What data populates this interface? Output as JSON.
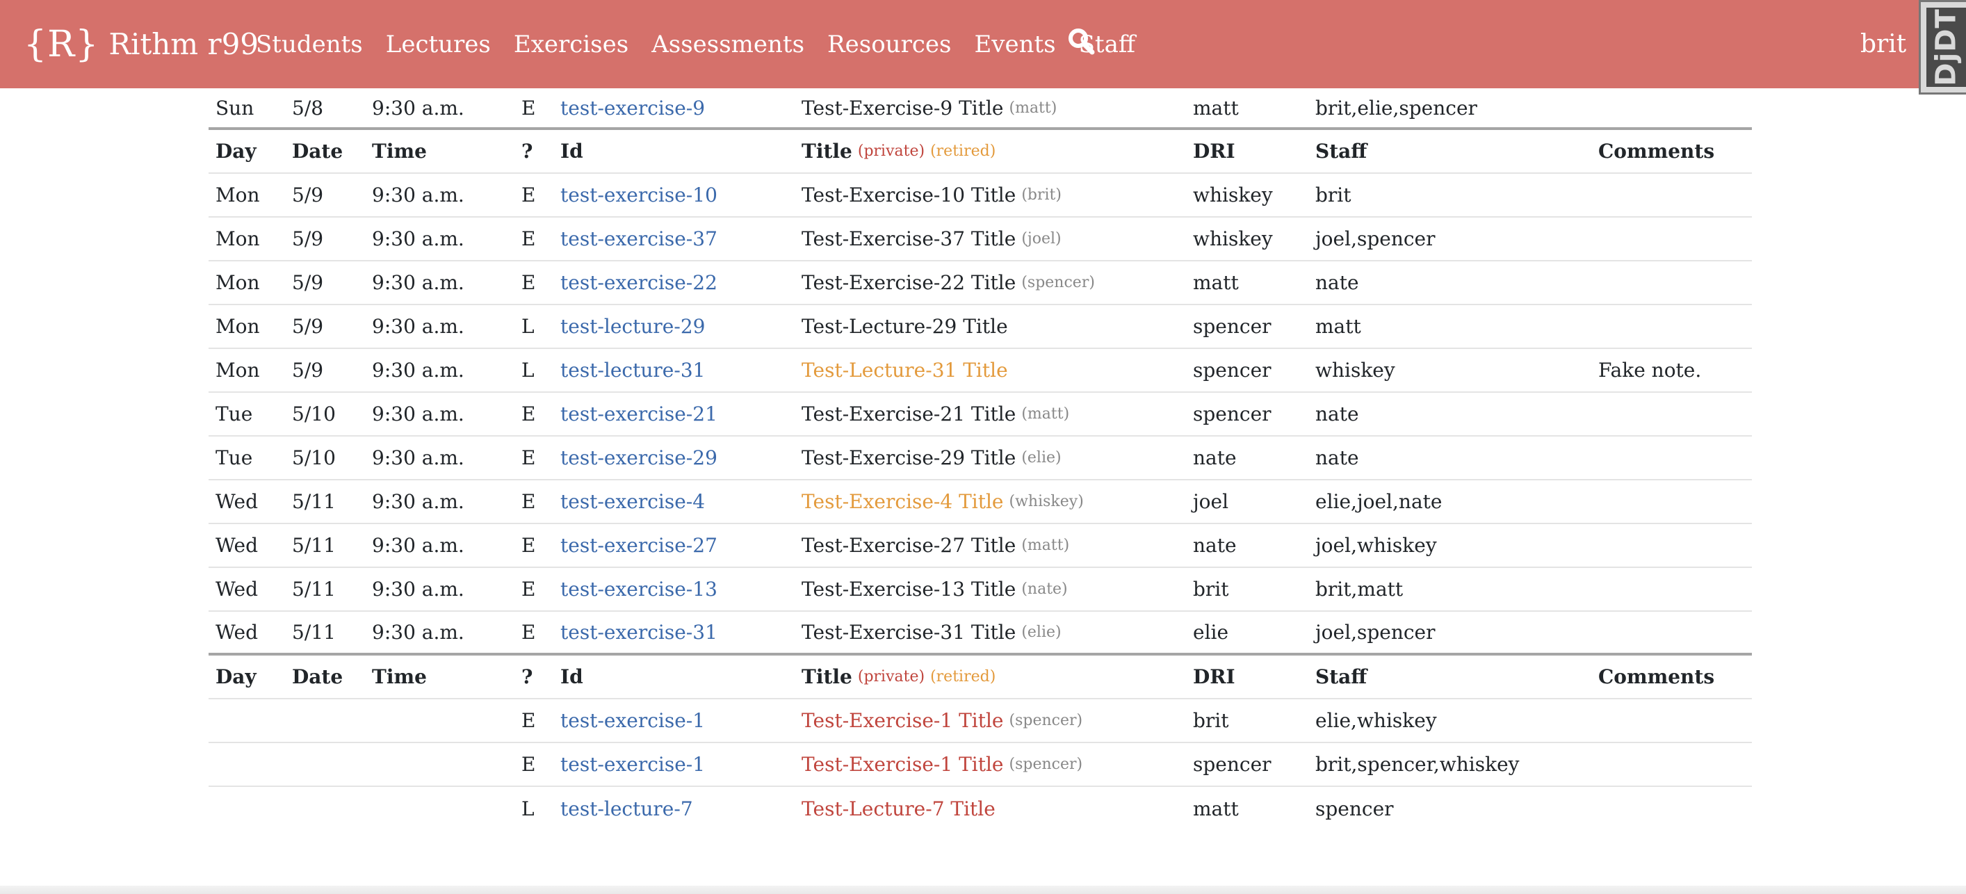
{
  "brand": {
    "mark": "{R}",
    "name": "Rithm r99"
  },
  "nav": [
    "Students",
    "Lectures",
    "Exercises",
    "Assessments",
    "Resources",
    "Events",
    "Staff"
  ],
  "user": {
    "name": "brit"
  },
  "djdt": "DjDT",
  "header": {
    "day": "Day",
    "date": "Date",
    "time": "Time",
    "kind": "?",
    "id": "Id",
    "title": "Title",
    "private": "(private)",
    "retired": "(retired)",
    "dri": "DRI",
    "staff": "Staff",
    "comments": "Comments"
  },
  "top_row": {
    "day": "Sun",
    "date": "5/8",
    "time": "9:30 a.m.",
    "kind": "E",
    "id": "test-exercise-9",
    "title": "Test-Exercise-9 Title",
    "owner": "(matt)",
    "dri": "matt",
    "staff": "brit,elie,spencer",
    "comments": ""
  },
  "rows": [
    {
      "day": "Mon",
      "date": "5/9",
      "time": "9:30 a.m.",
      "kind": "E",
      "id": "test-exercise-10",
      "title": "Test-Exercise-10 Title",
      "owner": "(brit)",
      "dri": "whiskey",
      "staff": "brit",
      "comments": ""
    },
    {
      "day": "Mon",
      "date": "5/9",
      "time": "9:30 a.m.",
      "kind": "E",
      "id": "test-exercise-37",
      "title": "Test-Exercise-37 Title",
      "owner": "(joel)",
      "dri": "whiskey",
      "staff": "joel,spencer",
      "comments": ""
    },
    {
      "day": "Mon",
      "date": "5/9",
      "time": "9:30 a.m.",
      "kind": "E",
      "id": "test-exercise-22",
      "title": "Test-Exercise-22 Title",
      "owner": "(spencer)",
      "dri": "matt",
      "staff": "nate",
      "comments": ""
    },
    {
      "day": "Mon",
      "date": "5/9",
      "time": "9:30 a.m.",
      "kind": "L",
      "id": "test-lecture-29",
      "title": "Test-Lecture-29 Title",
      "owner": "",
      "dri": "spencer",
      "staff": "matt",
      "comments": ""
    },
    {
      "day": "Mon",
      "date": "5/9",
      "time": "9:30 a.m.",
      "kind": "L",
      "id": "test-lecture-31",
      "title": "Test-Lecture-31 Title",
      "owner": "",
      "dri": "spencer",
      "staff": "whiskey",
      "comments": "Fake note."
    },
    {
      "day": "Tue",
      "date": "5/10",
      "time": "9:30 a.m.",
      "kind": "E",
      "id": "test-exercise-21",
      "title": "Test-Exercise-21 Title",
      "owner": "(matt)",
      "dri": "spencer",
      "staff": "nate",
      "comments": ""
    },
    {
      "day": "Tue",
      "date": "5/10",
      "time": "9:30 a.m.",
      "kind": "E",
      "id": "test-exercise-29",
      "title": "Test-Exercise-29 Title",
      "owner": "(elie)",
      "dri": "nate",
      "staff": "nate",
      "comments": ""
    },
    {
      "day": "Wed",
      "date": "5/11",
      "time": "9:30 a.m.",
      "kind": "E",
      "id": "test-exercise-4",
      "title": "Test-Exercise-4 Title",
      "owner": "(whiskey)",
      "dri": "joel",
      "staff": "elie,joel,nate",
      "comments": ""
    },
    {
      "day": "Wed",
      "date": "5/11",
      "time": "9:30 a.m.",
      "kind": "E",
      "id": "test-exercise-27",
      "title": "Test-Exercise-27 Title",
      "owner": "(matt)",
      "dri": "nate",
      "staff": "joel,whiskey",
      "comments": ""
    },
    {
      "day": "Wed",
      "date": "5/11",
      "time": "9:30 a.m.",
      "kind": "E",
      "id": "test-exercise-13",
      "title": "Test-Exercise-13 Title",
      "owner": "(nate)",
      "dri": "brit",
      "staff": "brit,matt",
      "comments": ""
    },
    {
      "day": "Wed",
      "date": "5/11",
      "time": "9:30 a.m.",
      "kind": "E",
      "id": "test-exercise-31",
      "title": "Test-Exercise-31 Title",
      "owner": "(elie)",
      "dri": "elie",
      "staff": "joel,spencer",
      "comments": ""
    }
  ],
  "unscheduled": [
    {
      "day": "",
      "date": "",
      "time": "",
      "kind": "E",
      "id": "test-exercise-1",
      "title": "Test-Exercise-1 Title",
      "owner": "(spencer)",
      "dri": "brit",
      "staff": "elie,whiskey",
      "comments": ""
    },
    {
      "day": "",
      "date": "",
      "time": "",
      "kind": "E",
      "id": "test-exercise-1",
      "title": "Test-Exercise-1 Title",
      "owner": "(spencer)",
      "dri": "spencer",
      "staff": "brit,spencer,whiskey",
      "comments": ""
    },
    {
      "day": "",
      "date": "",
      "time": "",
      "kind": "L",
      "id": "test-lecture-7",
      "title": "Test-Lecture-7 Title",
      "owner": "",
      "dri": "matt",
      "staff": "spencer",
      "comments": ""
    }
  ],
  "colors": {
    "navbar": "#d5716b",
    "link": "#3b69ab",
    "retired_title": "#e39a3c",
    "private_title": "#c0453d"
  }
}
